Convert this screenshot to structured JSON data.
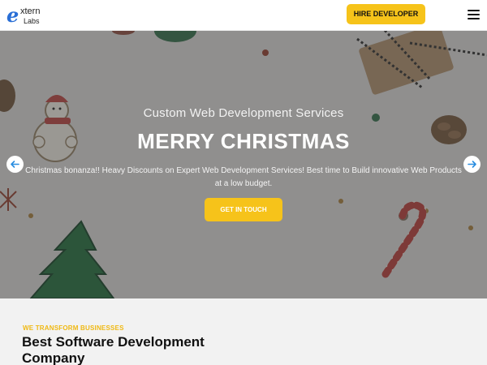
{
  "header": {
    "logo": {
      "mark": "e",
      "line1": "xtern",
      "line2": "Labs"
    },
    "hire_button": "HIRE DEVELOPER",
    "menu_icon": "hamburger-menu-icon"
  },
  "hero": {
    "subtitle": "Custom Web Development Services",
    "title": "MERRY CHRISTMAS",
    "description": "Christmas bonanza!! Heavy Discounts on Expert Web Development Services! Best time to Build innovative Web Products at a low budget.",
    "cta": "GET IN TOUCH",
    "prev_icon": "arrow-left-icon",
    "next_icon": "arrow-right-icon"
  },
  "about": {
    "eyebrow": "WE TRANSFORM BUSINESSES",
    "title": "Best Software Development Company"
  },
  "colors": {
    "accent": "#f6c31a",
    "arrow_blue": "#2a8de0",
    "text_dark": "#111111"
  }
}
